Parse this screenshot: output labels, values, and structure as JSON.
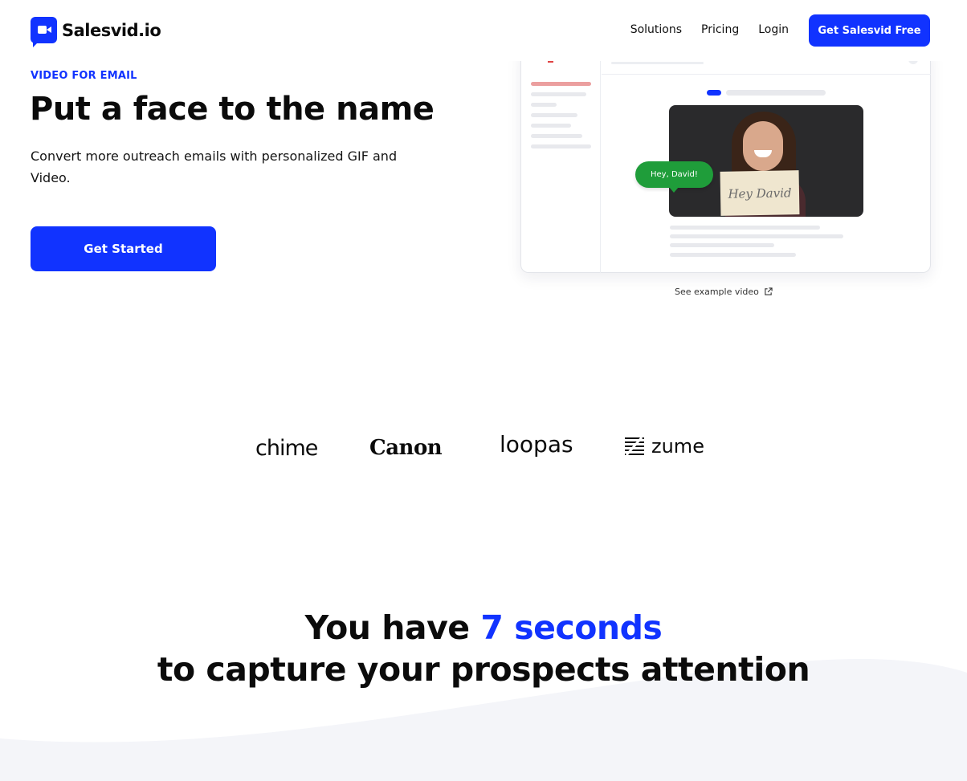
{
  "nav": {
    "brand": "Salesvid.io",
    "links": [
      "Solutions",
      "Pricing",
      "Login"
    ],
    "cta": "Get Salesvid Free"
  },
  "hero": {
    "eyebrow": "VIDEO FOR EMAIL",
    "title": "Put a face to the name",
    "subtitle": "Convert more outreach emails with personalized GIF and Video.",
    "cta": "Get Started"
  },
  "mockup": {
    "bubble": "Hey, David!",
    "card_text": "Hey David",
    "see_example": "See example video"
  },
  "logos": {
    "chime": "chime",
    "canon": "Canon",
    "loopas": "loopas",
    "zume": "zume"
  },
  "section": {
    "pre": "You have ",
    "highlight": "7 seconds",
    "post": " to capture your prospects attention"
  },
  "colors": {
    "brand": "#1133ff",
    "bubble": "#1f9d3a",
    "wave": "#f4f5f9"
  }
}
